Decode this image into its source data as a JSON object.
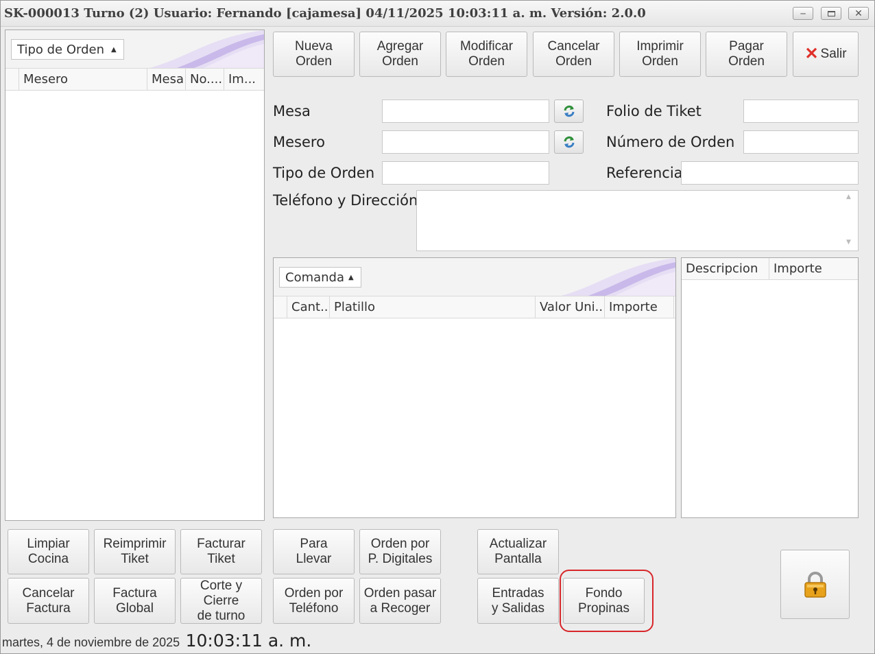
{
  "window": {
    "title": "SK-000013 Turno (2) Usuario: Fernando [cajamesa] 04/11/2025 10:03:11 a. m. Versión: 2.0.0",
    "controls": [
      "minimize",
      "maximize",
      "close"
    ]
  },
  "orders_grid": {
    "group_by_chip": "Tipo de Orden",
    "columns": [
      "Mesero",
      "Mesa",
      "No....",
      "Im..."
    ],
    "rows": []
  },
  "toolbar": {
    "nueva_orden": "Nueva\nOrden",
    "agregar_orden": "Agregar\nOrden",
    "modificar_orden": "Modificar\nOrden",
    "cancelar_orden": "Cancelar\nOrden",
    "imprimir_orden": "Imprimir\nOrden",
    "pagar_orden": "Pagar\nOrden",
    "salir": "Salir"
  },
  "form": {
    "mesa_label": "Mesa",
    "mesa_value": "",
    "mesero_label": "Mesero",
    "mesero_value": "",
    "tipo_orden_label": "Tipo de Orden",
    "tipo_orden_value": "",
    "telefono_label": "Teléfono y Dirección",
    "telefono_value": "",
    "folio_label": "Folio de Tiket",
    "folio_value": "",
    "numero_orden_label": "Número de Orden",
    "numero_orden_value": "",
    "referencia_label": "Referencia",
    "referencia_value": ""
  },
  "comanda_grid": {
    "group_by_chip": "Comanda",
    "columns": [
      "Cant...",
      "Platillo",
      "Valor Uni...",
      "Importe"
    ],
    "rows": []
  },
  "extras_grid": {
    "columns": [
      "Descripcion",
      "Importe"
    ],
    "rows": []
  },
  "bottom_buttons": {
    "limpiar_cocina": "Limpiar\nCocina",
    "reimprimir_tiket": "Reimprimir\nTiket",
    "facturar_tiket": "Facturar\nTiket",
    "para_llevar": "Para\nLlevar",
    "orden_digitales": "Orden por\nP. Digitales",
    "actualizar_pantalla": "Actualizar\nPantalla",
    "cancelar_factura": "Cancelar\nFactura",
    "factura_global": "Factura\nGlobal",
    "corte_cierre": "Corte y Cierre\nde turno",
    "orden_telefono": "Orden por\nTeléfono",
    "orden_recoger": "Orden pasar\na Recoger",
    "entradas_salidas": "Entradas\ny Salidas",
    "fondo_propinas": "Fondo\nPropinas"
  },
  "status": {
    "date": "martes, 4 de noviembre de 2025",
    "time": "10:03:11 a. m."
  },
  "colors": {
    "highlight": "#d8262a",
    "close_x": "#e0302a",
    "lock": "#e8a21c"
  }
}
